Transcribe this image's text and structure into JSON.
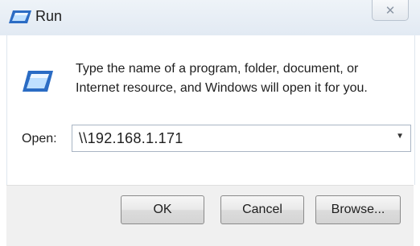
{
  "window": {
    "title": "Run",
    "close_glyph": "✕"
  },
  "dialog": {
    "message_line1": "Type the name of a program, folder, document, or",
    "message_line2": "Internet resource, and Windows will open it for you.",
    "open_label": "Open:",
    "open_value": "\\\\192.168.1.171",
    "dropdown_glyph": "▼"
  },
  "buttons": {
    "ok": "OK",
    "cancel": "Cancel",
    "browse": "Browse..."
  },
  "icons": {
    "title": "run-icon",
    "main": "run-icon"
  },
  "colors": {
    "icon_blue": "#2b6cc4",
    "window_frame": "#e6eef6"
  }
}
